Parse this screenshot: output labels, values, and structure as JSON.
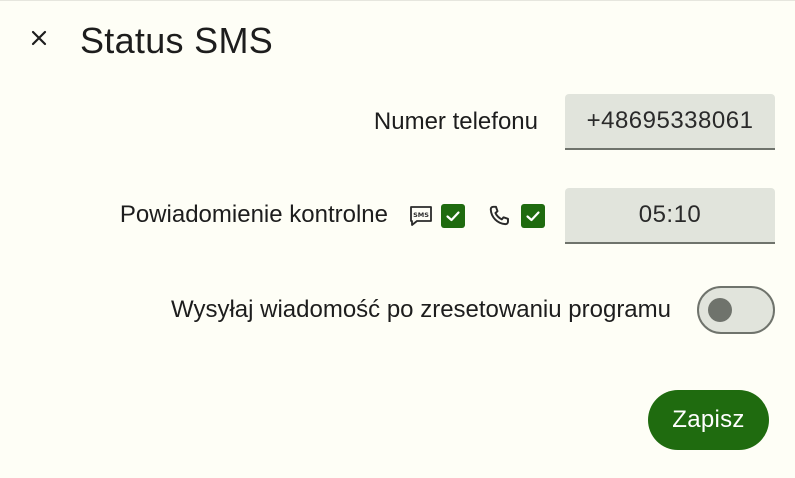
{
  "dialog": {
    "title": "Status SMS",
    "close_icon": "close-icon"
  },
  "phone": {
    "label": "Numer telefonu",
    "value": "+48695338061"
  },
  "control_notification": {
    "label": "Powiadomienie kontrolne",
    "sms_icon": "sms-icon",
    "sms_checked": true,
    "call_icon": "phone-icon",
    "call_checked": true,
    "time_value": "05:10"
  },
  "reset_message": {
    "label": "Wysyłaj wiadomość po zresetowaniu programu",
    "enabled": false
  },
  "actions": {
    "save_label": "Zapisz"
  },
  "colors": {
    "background": "#fefef6",
    "accent": "#1f6b0f",
    "field_bg": "#e1e4dc",
    "outline": "#6f736c"
  }
}
